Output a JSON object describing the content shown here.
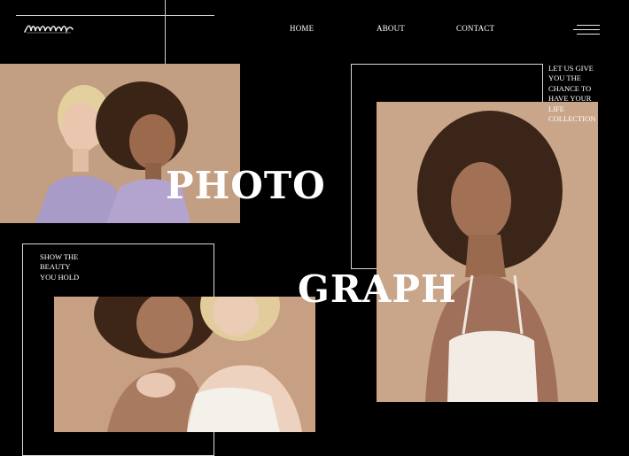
{
  "brand": {
    "logo_text": "Lorem",
    "logo_icon": "script-logo"
  },
  "nav": {
    "items": [
      {
        "label": "HOME"
      },
      {
        "label": "ABOUT"
      },
      {
        "label": "CONTACT"
      }
    ],
    "menu_icon": "hamburger-menu-icon"
  },
  "hero": {
    "headline_top": "PHOTO",
    "headline_bottom": "GRAPH",
    "caption_right": [
      "LET US GIVE",
      "YOU THE",
      "CHANCE TO",
      "HAVE YOUR",
      "LIFE",
      "COLLECTION"
    ],
    "caption_left": [
      "SHOW THE",
      "BEAUTY",
      "YOU HOLD"
    ]
  },
  "photos": [
    {
      "name": "two-women-back-to-back"
    },
    {
      "name": "curly-hair-woman-portrait"
    },
    {
      "name": "two-women-close-up"
    }
  ],
  "colors": {
    "background": "#000000",
    "text": "#ffffff",
    "lines": "#cfcfcf",
    "photo_backdrop": "#c7a184"
  }
}
